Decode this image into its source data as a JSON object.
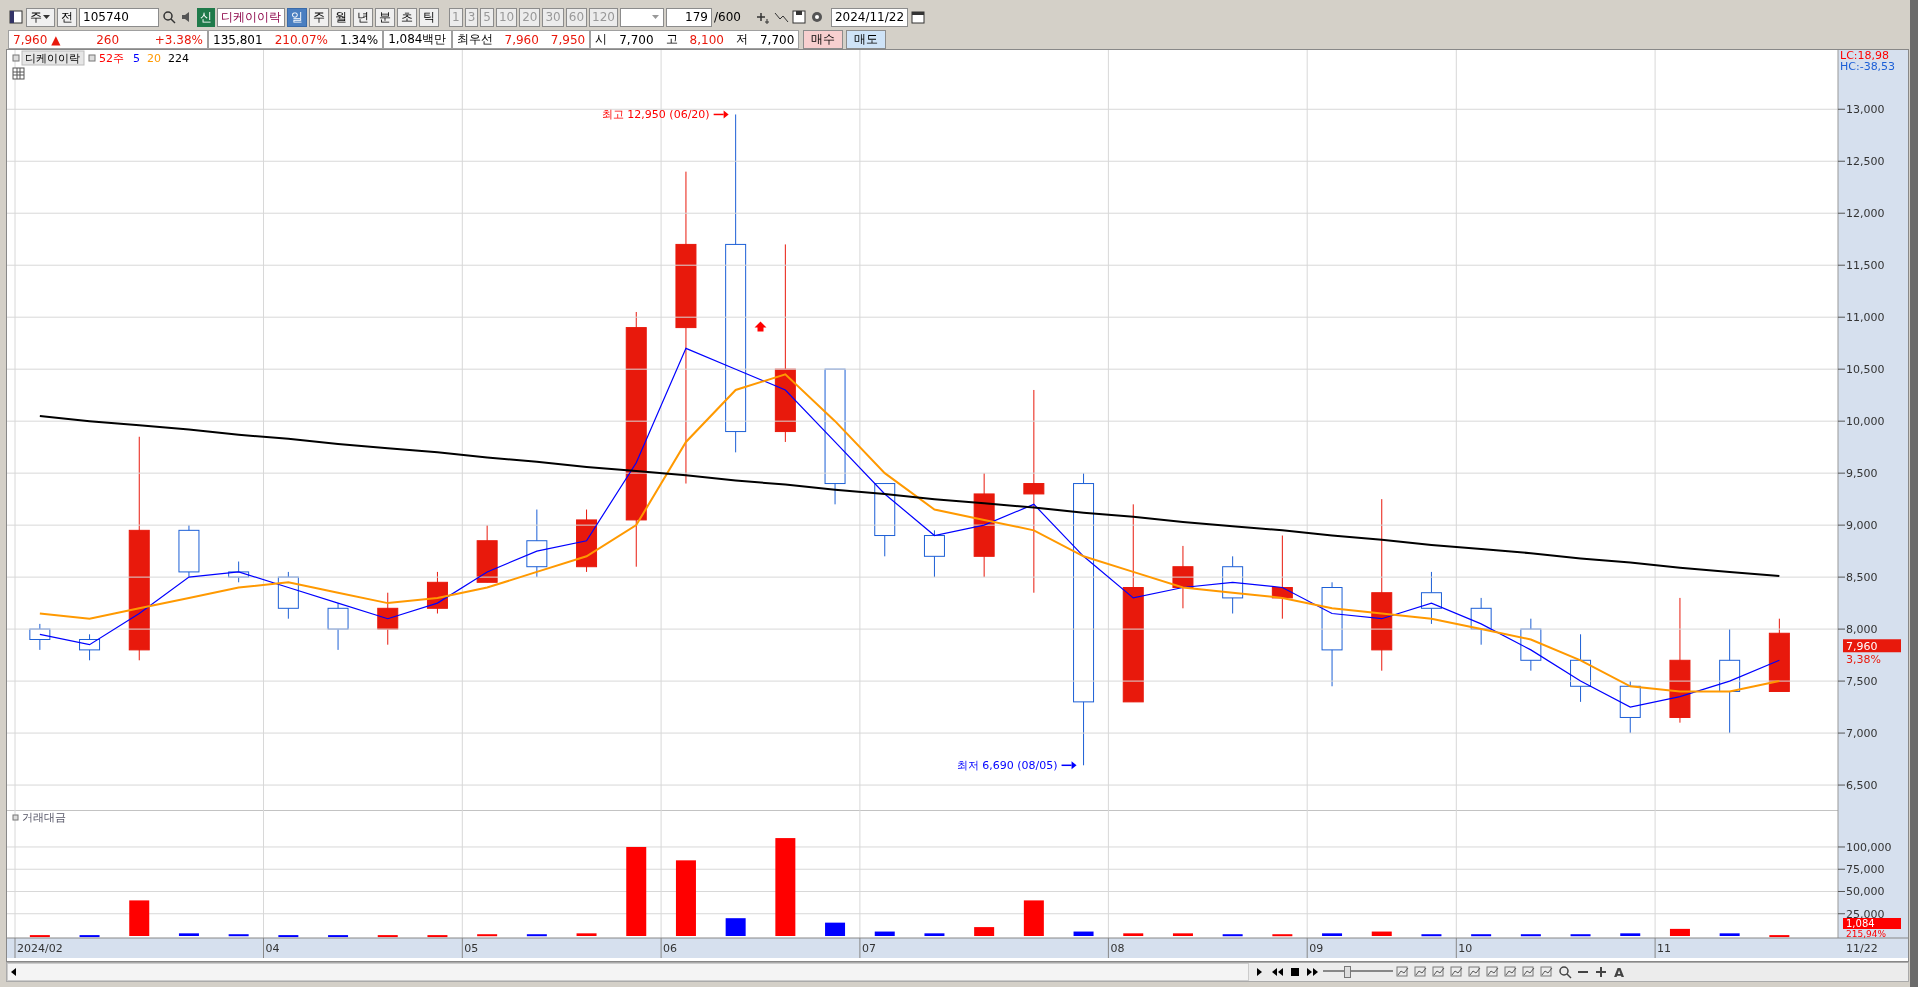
{
  "toolbar": {
    "market": "주",
    "kind_button": "전",
    "code": "105740",
    "badge": "신",
    "name": "디케이이락",
    "periods": [
      {
        "label": "일",
        "selected": true
      },
      {
        "label": "주",
        "selected": false
      },
      {
        "label": "월",
        "selected": false
      },
      {
        "label": "년",
        "selected": false
      },
      {
        "label": "분",
        "selected": false
      },
      {
        "label": "초",
        "selected": false
      },
      {
        "label": "틱",
        "selected": false
      }
    ],
    "intervals": [
      "1",
      "3",
      "5",
      "10",
      "20",
      "30",
      "60",
      "120"
    ],
    "count": "179",
    "total": "/600",
    "date": "2024/11/22"
  },
  "quote": {
    "groups": [
      [
        {
          "text": "7,960 ▲",
          "kind": "up"
        },
        {
          "text": "260",
          "kind": "up"
        },
        {
          "text": "+3.38%",
          "kind": "up"
        }
      ],
      [
        {
          "text": "135,801",
          "kind": "plain"
        },
        {
          "text": "210.07%",
          "kind": "up"
        },
        {
          "text": "1.34%",
          "kind": "plain"
        }
      ],
      [
        {
          "text": "1,084백만",
          "kind": "plain"
        }
      ],
      [
        {
          "text": "최우선",
          "kind": "plain"
        },
        {
          "text": "7,960",
          "kind": "up"
        },
        {
          "text": "7,950",
          "kind": "up"
        }
      ],
      [
        {
          "text": "시",
          "kind": "plain"
        },
        {
          "text": "7,700",
          "kind": "plain"
        },
        {
          "text": "고",
          "kind": "plain"
        },
        {
          "text": "8,100",
          "kind": "up"
        },
        {
          "text": "저",
          "kind": "plain"
        },
        {
          "text": "7,700",
          "kind": "plain"
        }
      ]
    ],
    "buttons": [
      {
        "label": "매수",
        "kind": "buy"
      },
      {
        "label": "매도",
        "kind": "sell"
      }
    ]
  },
  "price_panel": {
    "legend": {
      "name": "디케이이락",
      "items": [
        {
          "label": "52주",
          "color": "#ff0000"
        }
      ]
    },
    "lc": "LC:18,98",
    "hc": "HC:-38,53",
    "price_tag": "7,960",
    "change_tag": "3,38%",
    "chart_data": {
      "type": "line",
      "grid": true,
      "ylim": [
        6260,
        13570
      ],
      "yticks": [
        {
          "value": 6500,
          "label": "6,500"
        },
        {
          "value": 7000,
          "label": "7,000"
        },
        {
          "value": 7500,
          "label": "7,500"
        },
        {
          "value": 8000,
          "label": "8,000"
        },
        {
          "value": 8500,
          "label": "8,500"
        },
        {
          "value": 9000,
          "label": "9,000"
        },
        {
          "value": 9500,
          "label": "9,500"
        },
        {
          "value": 10000,
          "label": "10,000"
        },
        {
          "value": 10500,
          "label": "10,500"
        },
        {
          "value": 11000,
          "label": "11,000"
        },
        {
          "value": 11500,
          "label": "11,500"
        },
        {
          "value": 12000,
          "label": "12,000"
        },
        {
          "value": 12500,
          "label": "12,500"
        },
        {
          "value": 13000,
          "label": "13,000"
        }
      ],
      "series": [
        {
          "name": "5",
          "color": "#0000ff",
          "values": [
            7950,
            7850,
            8150,
            8500,
            8550,
            8400,
            8250,
            8100,
            8250,
            8550,
            8750,
            8850,
            9600,
            10700,
            10500,
            10300,
            9800,
            9300,
            8900,
            9000,
            9200,
            8700,
            8300,
            8400,
            8450,
            8400,
            8150,
            8100,
            8250,
            8050,
            7800,
            7500,
            7250,
            7350,
            7500,
            7700
          ]
        },
        {
          "name": "20",
          "color": "#ff9900",
          "values": [
            8150,
            8100,
            8200,
            8300,
            8400,
            8450,
            8350,
            8250,
            8300,
            8400,
            8550,
            8700,
            9000,
            9800,
            10300,
            10450,
            10000,
            9500,
            9150,
            9050,
            8950,
            8700,
            8550,
            8400,
            8350,
            8300,
            8200,
            8150,
            8100,
            8000,
            7900,
            7700,
            7450,
            7400,
            7400,
            7500
          ]
        },
        {
          "name": "224",
          "color": "#000000",
          "values": [
            10050,
            10000,
            9960,
            9920,
            9870,
            9830,
            9780,
            9740,
            9700,
            9650,
            9610,
            9560,
            9520,
            9480,
            9430,
            9390,
            9340,
            9300,
            9250,
            9210,
            9170,
            9120,
            9080,
            9030,
            8990,
            8950,
            8900,
            8860,
            8810,
            8770,
            8730,
            8680,
            8640,
            8590,
            8550,
            8510
          ]
        }
      ],
      "annotations": [
        "최고 12,950 (06/20)",
        "최저 6,690 (08/05)"
      ]
    }
  },
  "volume_panel": {
    "title": "거래대금",
    "value_tag": "1,084",
    "ratio_tag": "215,94%",
    "chart_data": {
      "type": "bar",
      "grid": true,
      "x": [
        "2024/02",
        null,
        null,
        null,
        null,
        "04",
        null,
        null,
        null,
        "05",
        null,
        null,
        null,
        "06",
        null,
        null,
        null,
        "07",
        null,
        null,
        null,
        null,
        "08",
        null,
        null,
        null,
        "09",
        null,
        null,
        "10",
        null,
        null,
        null,
        "11",
        null,
        null
      ],
      "ylim": [
        0,
        139300
      ],
      "yticks": [
        {
          "value": 25000,
          "label": "25,000"
        },
        {
          "value": 50000,
          "label": "50,000"
        },
        {
          "value": 75000,
          "label": "75,000"
        },
        {
          "value": 100000,
          "label": "100,000"
        }
      ],
      "values": [
        1000,
        1000,
        40000,
        3000,
        2000,
        1000,
        1000,
        1000,
        1000,
        2000,
        2000,
        3000,
        100000,
        85000,
        20000,
        110000,
        15000,
        5000,
        3000,
        10000,
        40000,
        5000,
        3000,
        3000,
        2000,
        2000,
        3000,
        5000,
        2000,
        2000,
        2000,
        2000,
        3000,
        8000,
        3000,
        1000
      ]
    }
  },
  "date_axis": {
    "end_label": "11/22"
  },
  "bottom": {
    "zoom": {
      "level": 0.33
    },
    "font_button": "A"
  }
}
